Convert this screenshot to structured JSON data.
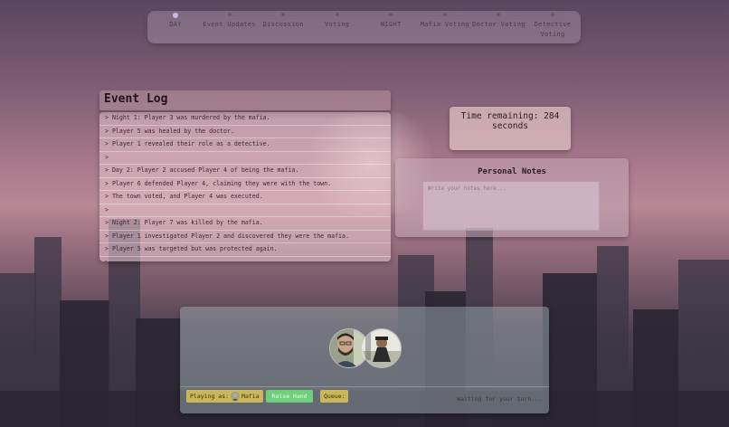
{
  "phases": [
    {
      "label": "DAY",
      "active": true
    },
    {
      "label": "Event Updates",
      "active": false
    },
    {
      "label": "Discussion",
      "active": false
    },
    {
      "label": "Voting",
      "active": false
    },
    {
      "label": "NIGHT",
      "active": false
    },
    {
      "label": "Mafia Voting",
      "active": false
    },
    {
      "label": "Doctor Voting",
      "active": false
    },
    {
      "label": "Detective Voting",
      "active": false
    }
  ],
  "event_log": {
    "title": "Event Log",
    "entries": [
      "> Night 1: Player 3 was murdered by the mafia.",
      "> Player 5 was healed by the doctor.",
      "> Player 1 revealed their role as a detective.",
      ">",
      "> Day 2: Player 2 accused Player 4 of being the mafia.",
      "> Player 6 defended Player 4, claiming they were with the town.",
      "> The town voted, and Player 4 was executed.",
      ">",
      "> Night 2: Player 7 was killed by the mafia.",
      "> Player 1 investigated Player 2 and discovered they were the mafia.",
      "> Player 5 was targeted but was protected again.",
      ">"
    ]
  },
  "timer": {
    "text": "Time remaining: 284 seconds"
  },
  "notes": {
    "title": "Personal Notes",
    "placeholder": "Write your notes here..."
  },
  "controls": {
    "playing_as_label": "Playing as:",
    "role": "Mafia",
    "raise_hand": "Raise Hand",
    "queue": "Queue:",
    "status": "Waiting for your turn..."
  },
  "colors": {
    "raise_hand": "#6fcf7a",
    "badge": "#c9b85a",
    "active_phase_dot": "#c8b8e8"
  },
  "icons": {
    "player_avatars": [
      "avatar-bearded-man-glasses",
      "avatar-person-hat"
    ]
  }
}
